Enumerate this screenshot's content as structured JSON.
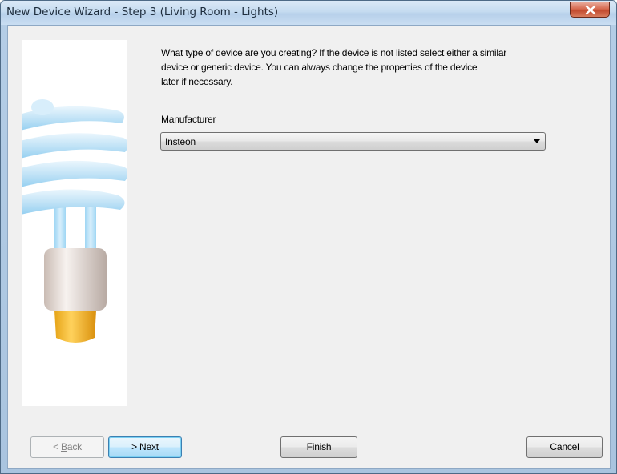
{
  "window": {
    "title": "New Device Wizard - Step 3 (Living Room - Lights)",
    "close_icon": "close-icon"
  },
  "content": {
    "description_lines": [
      "What type of device are you creating?  If the device is not listed select either a similar",
      "device or generic device.  You can always change the properties of the device",
      "later if necessary."
    ],
    "manufacturer_label": "Manufacturer",
    "manufacturer_value": "Insteon"
  },
  "buttons": {
    "back_prefix": "< ",
    "back_mnemonic": "B",
    "back_rest": "ack",
    "next": "> Next",
    "finish": "Finish",
    "cancel": "Cancel"
  },
  "side_image": "cfl-light-bulb-illustration"
}
